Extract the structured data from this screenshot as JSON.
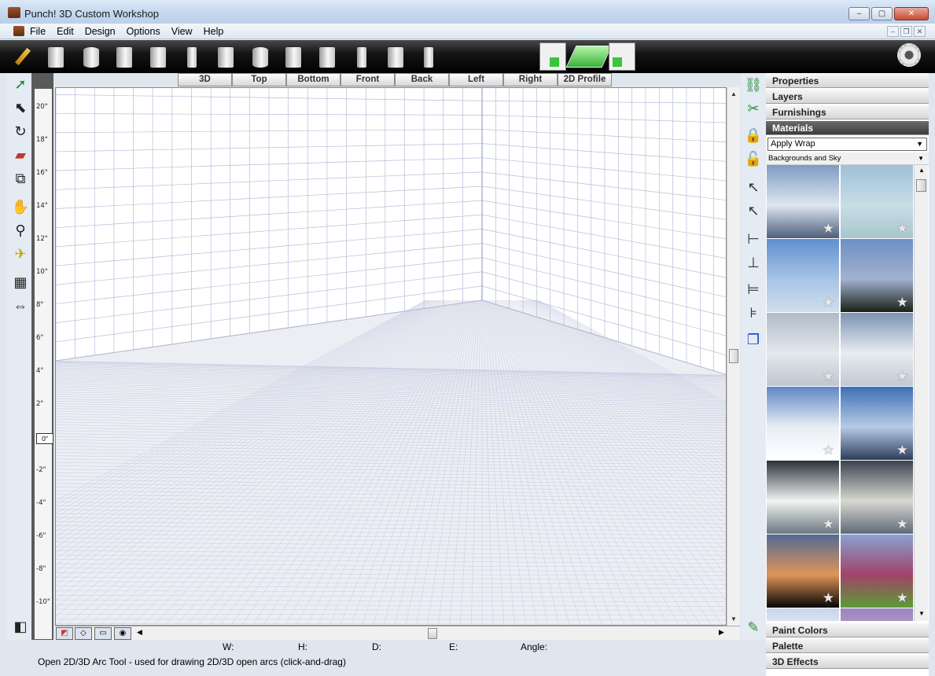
{
  "window": {
    "title": "Punch! 3D Custom Workshop",
    "minimize": "–",
    "maximize": "▢",
    "close": "✕"
  },
  "menu": [
    "File",
    "Edit",
    "Design",
    "Options",
    "View",
    "Help"
  ],
  "mdi": {
    "minimize": "–",
    "restore": "❐",
    "close": "✕"
  },
  "view_tabs": [
    "3D",
    "Top",
    "Bottom",
    "Front",
    "Back",
    "Left",
    "Right",
    "2D Profile"
  ],
  "ruler_ticks": [
    "20\"",
    "18\"",
    "16\"",
    "14\"",
    "12\"",
    "10\"",
    "8\"",
    "6\"",
    "4\"",
    "2\"",
    "-2\"",
    "-4\"",
    "-6\"",
    "-8\"",
    "-10\""
  ],
  "ruler_zero": "0\"",
  "panel": {
    "properties": "Properties",
    "layers": "Layers",
    "furnishings": "Furnishings",
    "materials": "Materials",
    "apply_mode": "Apply Wrap",
    "category": "Backgrounds and Sky",
    "paint_colors": "Paint Colors",
    "palette": "Palette",
    "effects_3d": "3D Effects"
  },
  "swatches": [
    {
      "icon": "sky-cumulus",
      "colors": [
        "#7f9bc4",
        "#dfe6f0",
        "#4c5e7a"
      ]
    },
    {
      "icon": "sky-pale-blue",
      "colors": [
        "#9fc0d8",
        "#c8dde6",
        "#a8c6cc"
      ]
    },
    {
      "icon": "sky-light-blue",
      "colors": [
        "#5f8fcf",
        "#a8c4e6",
        "#d0deee"
      ]
    },
    {
      "icon": "sky-dusk-trees",
      "colors": [
        "#6f8fc6",
        "#a0b2cf",
        "#1a2016"
      ]
    },
    {
      "icon": "sky-overcast",
      "colors": [
        "#b0bac6",
        "#e4e8ee",
        "#bfc6cf"
      ]
    },
    {
      "icon": "sky-grey-clouds",
      "colors": [
        "#7c93b4",
        "#e8ecf1",
        "#c0c8d3"
      ]
    },
    {
      "icon": "sky-fluffy-clouds",
      "colors": [
        "#5f87c6",
        "#e8edf4",
        "#ffffff"
      ]
    },
    {
      "icon": "sky-mountains",
      "colors": [
        "#3d6fb3",
        "#b6cbe6",
        "#2d3e5c"
      ]
    },
    {
      "icon": "sky-storm-sun",
      "colors": [
        "#2b3138",
        "#f1f4f1",
        "#6a7880"
      ]
    },
    {
      "icon": "sky-sunset-clouds",
      "colors": [
        "#3a4350",
        "#d8d8d0",
        "#5d6a78"
      ]
    },
    {
      "icon": "sky-sunset",
      "colors": [
        "#526a92",
        "#e0945a",
        "#050505"
      ]
    },
    {
      "icon": "sky-meadow",
      "colors": [
        "#8aa2d0",
        "#a0426a",
        "#5c9c35"
      ]
    },
    {
      "icon": "sky-clouds-top",
      "colors": [
        "#c7d4ea",
        "#ffffff",
        "#9fb2d6"
      ]
    },
    {
      "icon": "sky-purple-dusk",
      "colors": [
        "#9a86c0",
        "#c9a8d4",
        "#6a5a9c"
      ]
    }
  ],
  "status": {
    "w_label": "W:",
    "h_label": "H:",
    "d_label": "D:",
    "e_label": "E:",
    "angle_label": "Angle:",
    "message": "Open 2D/3D Arc Tool - used for drawing 2D/3D open arcs (click-and-drag)"
  },
  "colors": {
    "toolbar": "#000000",
    "active_header": "#4a4a4a",
    "grid_line": "#b7bdd8"
  }
}
